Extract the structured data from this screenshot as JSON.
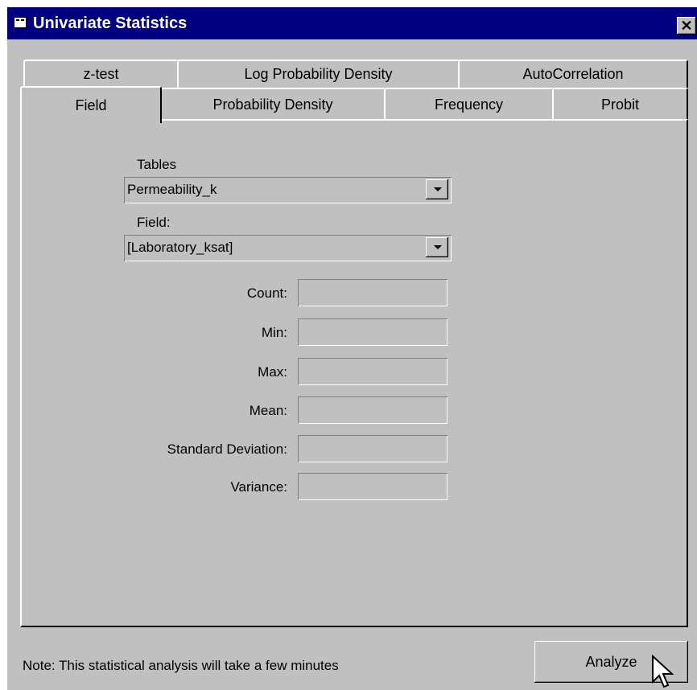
{
  "window": {
    "title": "Univariate Statistics",
    "close_glyph": "✕"
  },
  "tabs_back": [
    "z-test",
    "Log Probability Density",
    "AutoCorrelation"
  ],
  "tabs_front": [
    "Field",
    "Probability Density",
    "Frequency",
    "Probit"
  ],
  "active_tab": "Field",
  "form": {
    "tables_label": "Tables",
    "tables_value": "Permeability_k",
    "field_label": "Field:",
    "field_value": "[Laboratory_ksat]",
    "stats": [
      {
        "label": "Count:",
        "value": ""
      },
      {
        "label": "Min:",
        "value": ""
      },
      {
        "label": "Max:",
        "value": ""
      },
      {
        "label": "Mean:",
        "value": ""
      },
      {
        "label": "Standard Deviation:",
        "value": ""
      },
      {
        "label": "Variance:",
        "value": ""
      }
    ]
  },
  "footer": {
    "note": "Note: This statistical analysis will take a few minutes",
    "analyze_label": "Analyze"
  },
  "icons": {
    "title": "form-window-icon",
    "cursor": "mouse-pointer-icon"
  }
}
